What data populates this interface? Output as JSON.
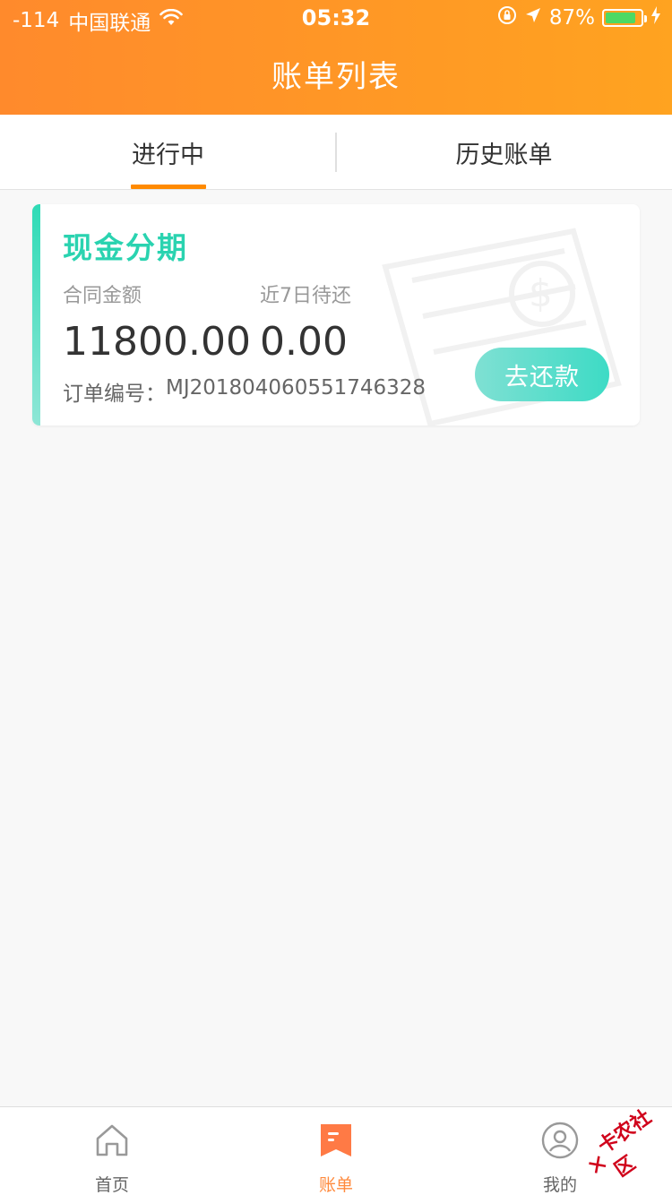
{
  "status_bar": {
    "signal": "-114",
    "carrier": "中国联通",
    "time": "05:32",
    "battery": "87%",
    "battery_level": 0.87
  },
  "nav": {
    "title": "账单列表"
  },
  "tabs": [
    {
      "label": "进行中",
      "active": true
    },
    {
      "label": "历史账单",
      "active": false
    }
  ],
  "bill": {
    "title": "现金分期",
    "contract_label": "合同金额",
    "due_label": "近7日待还",
    "contract_amount": "11800.00",
    "due_amount": "0.00",
    "order_label": "订单编号：",
    "order_number": "MJ201804060551746328",
    "pay_button": "去还款"
  },
  "tabbar": [
    {
      "label": "首页",
      "icon": "home-icon",
      "active": false
    },
    {
      "label": "账单",
      "icon": "bill-icon",
      "active": true
    },
    {
      "label": "我的",
      "icon": "user-icon",
      "active": false
    }
  ],
  "watermark_logo": "卡农社区",
  "colors": {
    "header_start": "#ff8a2c",
    "header_end": "#ffa320",
    "accent_teal": "#2ad3b0",
    "active_tab": "#ff8a00",
    "active_tabbar": "#ff8a3d"
  }
}
